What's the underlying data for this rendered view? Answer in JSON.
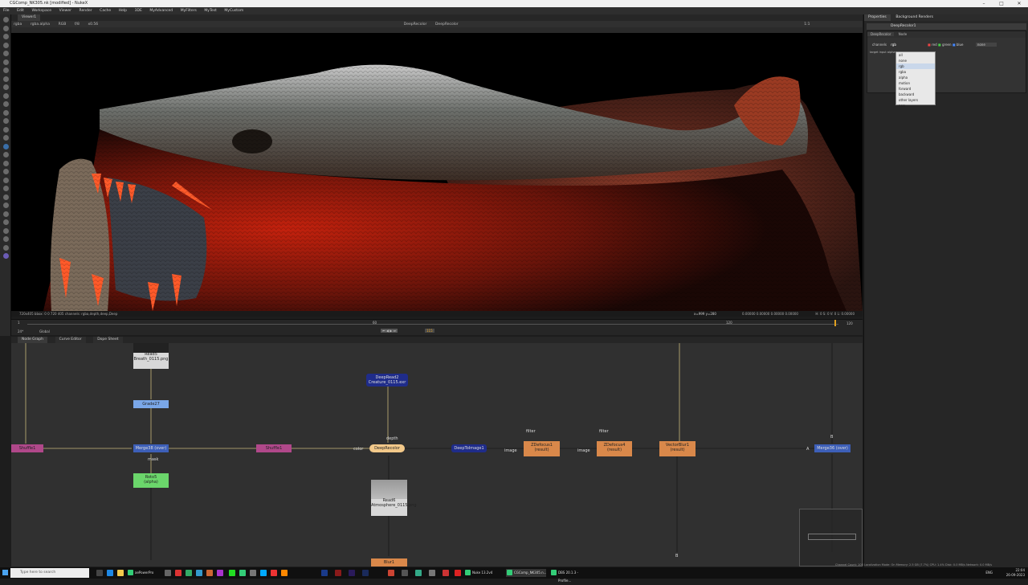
{
  "window": {
    "title": "CGComp_NK305.nk [modified] - NukeX"
  },
  "menu": [
    "File",
    "Edit",
    "Workspace",
    "Viewer",
    "Render",
    "Cache",
    "Help",
    "3DE",
    "MyAdvanced",
    "MyFilters",
    "MyTest",
    "MyCustom"
  ],
  "viewer": {
    "tab": "Viewer1",
    "channels": "rgba",
    "layer": "rgba.alpha",
    "colorspace": "RGB",
    "gain": "f/8",
    "zoom": "x0.56",
    "input_a": "DeepRecolor",
    "input_b": "DeepRecolor",
    "resolution": "1:1",
    "status_left": "720x405  bbox: 0 0 720 405 channels: rgba,depth,deep,Deep",
    "status_right": "x=999 y=280",
    "status_red": "0.00000  0.00000  0.00000  0.00000",
    "status_values": "H: 0 S: 0 V: 0 L: 0.00000"
  },
  "timeline": {
    "start": "1",
    "end": "120",
    "current_frame": "115",
    "fps_label": "24*",
    "mode": "Global",
    "mark_mid": "60",
    "mark_right": "120"
  },
  "nodegraph": {
    "tabs": [
      "Node Graph",
      "Curve Editor",
      "Dope Sheet"
    ],
    "nodes": {
      "read5": "Read5",
      "read5_file": "Breath_0115.png",
      "grade27": "Grade27",
      "shuffle_left": "Shuffle1",
      "merge38": "Merge38 (over)",
      "shuffle_mid": "Shuffle1",
      "roto5": "Roto5",
      "roto5_sub": "(alpha)",
      "deepread2": "DeepRead2",
      "deepread2_file": "Creature_0115.exr",
      "deeprecolor": "DeepRecolor",
      "deeptoimage": "DeepToImage1",
      "zdefocus1": "ZDefocus1",
      "zdefocus1_sub": "(result)",
      "zdefocus4": "ZDefocus4",
      "zdefocus4_sub": "(result)",
      "vectorblur": "VectorBlur1",
      "vectorblur_sub": "(result)",
      "merge36": "Merge36 (over)",
      "read6": "Read6",
      "read6_file": "Atmosphere_0115.png",
      "blur": "Blur1"
    },
    "labels": {
      "mask": "mask",
      "depth": "depth",
      "color": "color",
      "filter1": "filter",
      "filter2": "filter",
      "image1": "image",
      "image2": "image",
      "a": "A",
      "b_top": "B",
      "b_bottom": "B"
    }
  },
  "properties": {
    "tabs": [
      "Properties",
      "Background Renders"
    ],
    "node_name": "DeepRecolor1",
    "node_tabs": [
      "DeepRecolor",
      "Node"
    ],
    "channels_label": "channels",
    "channels_value": "rgb",
    "rgb_label": "red",
    "green_label": "green",
    "blue_label": "blue",
    "none_label": "none",
    "target_label": "target input alpha",
    "dropdown": [
      "all",
      "none",
      "rgb",
      "rgba",
      "alpha",
      "motion",
      "forward",
      "backward",
      "other layers",
      "new"
    ],
    "dropdown_selected": "rgb"
  },
  "status_bottom": "Channel Count: 105  Localization Mode: On  Memory: 2.5 GB (7.7%)  CPU: 1.4%  Disk: 0.0 MB/s  Network: 0.0 MB/s",
  "taskbar": {
    "search_placeholder": "Type here to search",
    "apps": [
      "aePowerPro",
      "Nuke 13.2v4",
      "CGComp_NK305.n...",
      "DBS 20.1.3 - Profile..."
    ],
    "time": "22:04",
    "date": "26-09-2023",
    "lang": "ENG"
  }
}
